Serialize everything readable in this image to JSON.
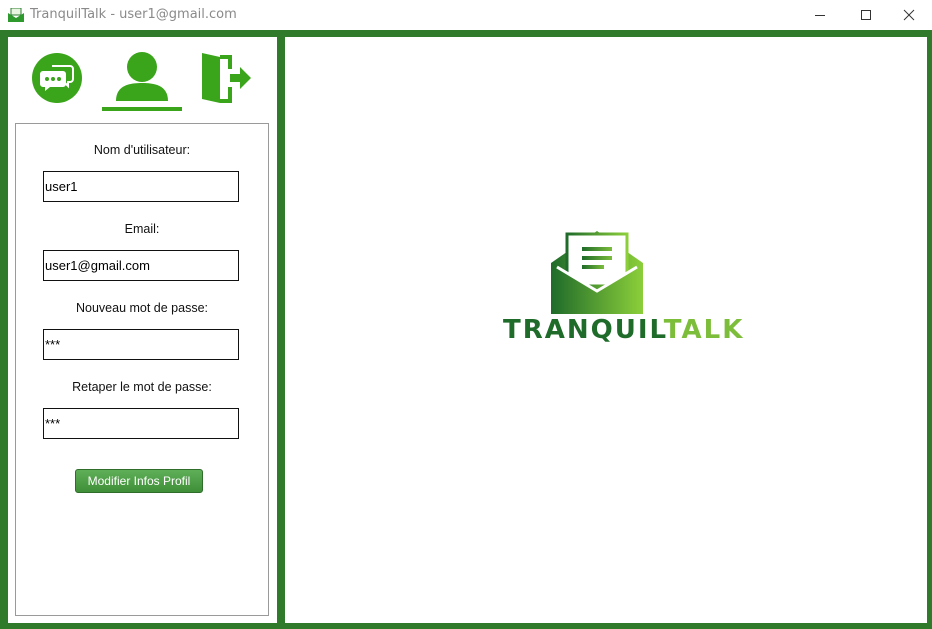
{
  "window": {
    "title": "TranquilTalk - user1@gmail.com",
    "controls": [
      "minimize-icon",
      "maximize-icon",
      "close-icon"
    ]
  },
  "nav": {
    "items": [
      {
        "name": "chat",
        "icon": "chat-bubbles-icon",
        "active": false
      },
      {
        "name": "profile",
        "icon": "user-icon",
        "active": true
      },
      {
        "name": "logout",
        "icon": "logout-door-icon",
        "active": false
      }
    ]
  },
  "profile_form": {
    "username_label": "Nom d'utilisateur:",
    "username_value": "user1",
    "email_label": "Email:",
    "email_value": "user1@gmail.com",
    "new_password_label": "Nouveau mot de passe:",
    "new_password_value": "***",
    "confirm_password_label": "Retaper le mot de passe:",
    "confirm_password_value": "***",
    "submit_label": "Modifier Infos Profil"
  },
  "logo": {
    "text_part1": "TRANQUIL",
    "text_part2": "TALK"
  },
  "colors": {
    "frame": "#2f7a2b",
    "accent": "#3aa51a",
    "logo_dark": "#1f6b2a",
    "logo_light": "#7cbd3a"
  }
}
